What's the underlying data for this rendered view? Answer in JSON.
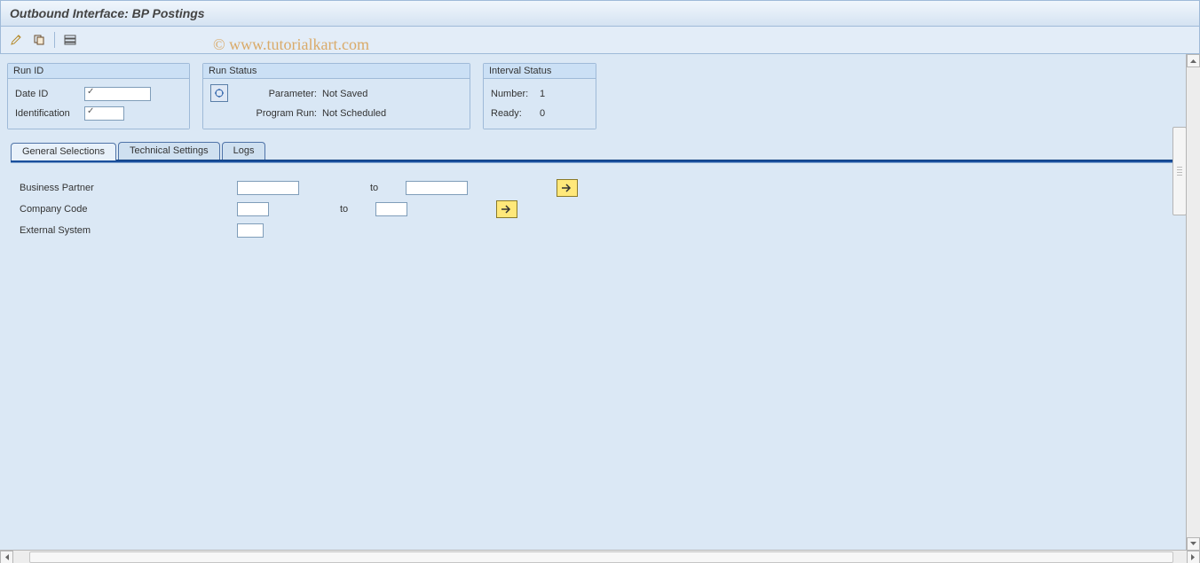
{
  "title": "Outbound Interface: BP Postings",
  "watermark": "© www.tutorialkart.com",
  "groups": {
    "run_id": {
      "title": "Run ID",
      "date_id_label": "Date ID",
      "date_id_value": "",
      "ident_label": "Identification",
      "ident_value": ""
    },
    "run_status": {
      "title": "Run Status",
      "parameter_label": "Parameter:",
      "parameter_value": "Not Saved",
      "program_run_label": "Program Run:",
      "program_run_value": "Not Scheduled"
    },
    "interval_status": {
      "title": "Interval Status",
      "number_label": "Number:",
      "number_value": "1",
      "ready_label": "Ready:",
      "ready_value": "0"
    }
  },
  "tabs": {
    "general": "General Selections",
    "technical": "Technical Settings",
    "logs": "Logs"
  },
  "selections": {
    "bp_label": "Business Partner",
    "bp_from": "",
    "bp_to_label": "to",
    "bp_to": "",
    "cc_label": "Company Code",
    "cc_from": "",
    "cc_to_label": "to",
    "cc_to": "",
    "ext_label": "External System",
    "ext_value": ""
  }
}
